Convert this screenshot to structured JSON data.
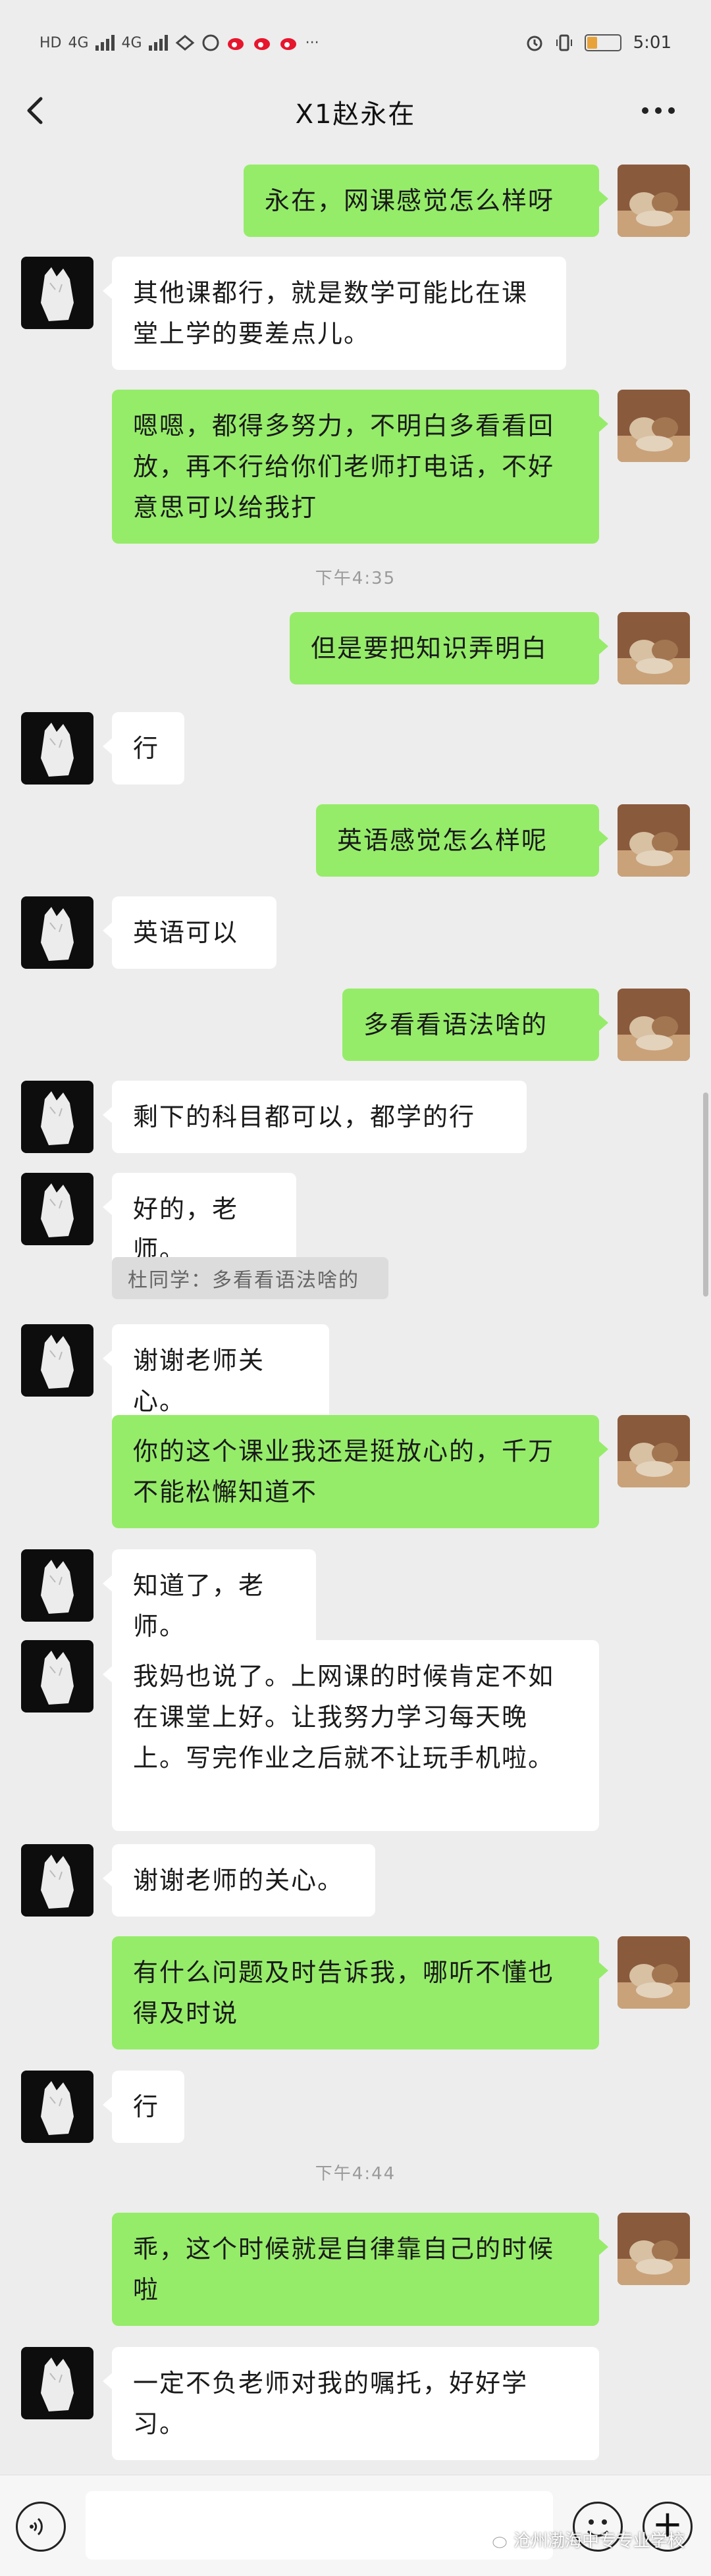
{
  "status_bar": {
    "network_label": "HD",
    "network_label_2": "HD",
    "signal_1": "4G",
    "signal_2": "4G",
    "more": "···",
    "time": "5:01"
  },
  "header": {
    "title": "X1赵永在",
    "back_icon": "chevron-left-icon",
    "more_icon": "more-dots-icon"
  },
  "messages": [
    {
      "side": "self",
      "text": "永在，网课感觉怎么样呀"
    },
    {
      "side": "other",
      "text": "其他课都行，就是数学可能比在课堂上学的要差点儿。"
    },
    {
      "side": "self",
      "text": "嗯嗯，都得多努力，不明白多看看回放，再不行给你们老师打电话，不好意思可以给我打"
    },
    {
      "side": "time",
      "text": "下午4:35"
    },
    {
      "side": "self",
      "text": "但是要把知识弄明白"
    },
    {
      "side": "other",
      "text": "行"
    },
    {
      "side": "self",
      "text": "英语感觉怎么样呢"
    },
    {
      "side": "other",
      "text": "英语可以"
    },
    {
      "side": "self",
      "text": "多看看语法啥的"
    },
    {
      "side": "other",
      "text": "剩下的科目都可以，都学的行"
    },
    {
      "side": "other",
      "text": "好的，老师。"
    },
    {
      "side": "quote",
      "text": "杜同学：多看看语法啥的"
    },
    {
      "side": "other",
      "text": "谢谢老师关心。"
    },
    {
      "side": "self",
      "text": "你的这个课业我还是挺放心的，千万不能松懈知道不"
    },
    {
      "side": "other",
      "text": "知道了，老师。"
    },
    {
      "side": "other",
      "text": "我妈也说了。上网课的时候肯定不如在课堂上好。让我努力学习每天晚上。写完作业之后就不让玩手机啦。"
    },
    {
      "side": "other",
      "text": "谢谢老师的关心。"
    },
    {
      "side": "self",
      "text": "有什么问题及时告诉我，哪听不懂也得及时说"
    },
    {
      "side": "other",
      "text": "行"
    },
    {
      "side": "time",
      "text": "下午4:44"
    },
    {
      "side": "self",
      "text": "乖，这个时候就是自律靠自己的时候啦"
    },
    {
      "side": "other",
      "text": "一定不负老师对我的嘱托，好好学习。"
    }
  ],
  "input_bar": {
    "voice_icon": "voice-icon",
    "emoji_icon": "emoji-icon",
    "plus_icon": "plus-icon",
    "plus_label": "+"
  },
  "watermark": {
    "text": "沧州渤海中专专业学校"
  },
  "colors": {
    "self_bubble": "#95ec69",
    "other_bubble": "#ffffff",
    "background": "#ededed"
  }
}
